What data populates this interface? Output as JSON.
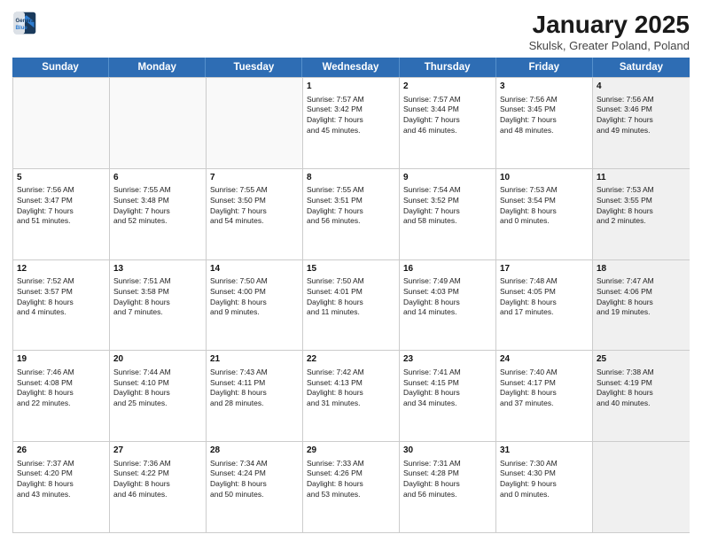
{
  "logo": {
    "line1": "General",
    "line2": "Blue"
  },
  "title": "January 2025",
  "subtitle": "Skulsk, Greater Poland, Poland",
  "days": [
    "Sunday",
    "Monday",
    "Tuesday",
    "Wednesday",
    "Thursday",
    "Friday",
    "Saturday"
  ],
  "weeks": [
    [
      {
        "day": "",
        "text": "",
        "empty": true
      },
      {
        "day": "",
        "text": "",
        "empty": true
      },
      {
        "day": "",
        "text": "",
        "empty": true
      },
      {
        "day": "1",
        "text": "Sunrise: 7:57 AM\nSunset: 3:42 PM\nDaylight: 7 hours\nand 45 minutes."
      },
      {
        "day": "2",
        "text": "Sunrise: 7:57 AM\nSunset: 3:44 PM\nDaylight: 7 hours\nand 46 minutes."
      },
      {
        "day": "3",
        "text": "Sunrise: 7:56 AM\nSunset: 3:45 PM\nDaylight: 7 hours\nand 48 minutes."
      },
      {
        "day": "4",
        "text": "Sunrise: 7:56 AM\nSunset: 3:46 PM\nDaylight: 7 hours\nand 49 minutes.",
        "shaded": true
      }
    ],
    [
      {
        "day": "5",
        "text": "Sunrise: 7:56 AM\nSunset: 3:47 PM\nDaylight: 7 hours\nand 51 minutes."
      },
      {
        "day": "6",
        "text": "Sunrise: 7:55 AM\nSunset: 3:48 PM\nDaylight: 7 hours\nand 52 minutes."
      },
      {
        "day": "7",
        "text": "Sunrise: 7:55 AM\nSunset: 3:50 PM\nDaylight: 7 hours\nand 54 minutes."
      },
      {
        "day": "8",
        "text": "Sunrise: 7:55 AM\nSunset: 3:51 PM\nDaylight: 7 hours\nand 56 minutes."
      },
      {
        "day": "9",
        "text": "Sunrise: 7:54 AM\nSunset: 3:52 PM\nDaylight: 7 hours\nand 58 minutes."
      },
      {
        "day": "10",
        "text": "Sunrise: 7:53 AM\nSunset: 3:54 PM\nDaylight: 8 hours\nand 0 minutes."
      },
      {
        "day": "11",
        "text": "Sunrise: 7:53 AM\nSunset: 3:55 PM\nDaylight: 8 hours\nand 2 minutes.",
        "shaded": true
      }
    ],
    [
      {
        "day": "12",
        "text": "Sunrise: 7:52 AM\nSunset: 3:57 PM\nDaylight: 8 hours\nand 4 minutes."
      },
      {
        "day": "13",
        "text": "Sunrise: 7:51 AM\nSunset: 3:58 PM\nDaylight: 8 hours\nand 7 minutes."
      },
      {
        "day": "14",
        "text": "Sunrise: 7:50 AM\nSunset: 4:00 PM\nDaylight: 8 hours\nand 9 minutes."
      },
      {
        "day": "15",
        "text": "Sunrise: 7:50 AM\nSunset: 4:01 PM\nDaylight: 8 hours\nand 11 minutes."
      },
      {
        "day": "16",
        "text": "Sunrise: 7:49 AM\nSunset: 4:03 PM\nDaylight: 8 hours\nand 14 minutes."
      },
      {
        "day": "17",
        "text": "Sunrise: 7:48 AM\nSunset: 4:05 PM\nDaylight: 8 hours\nand 17 minutes."
      },
      {
        "day": "18",
        "text": "Sunrise: 7:47 AM\nSunset: 4:06 PM\nDaylight: 8 hours\nand 19 minutes.",
        "shaded": true
      }
    ],
    [
      {
        "day": "19",
        "text": "Sunrise: 7:46 AM\nSunset: 4:08 PM\nDaylight: 8 hours\nand 22 minutes."
      },
      {
        "day": "20",
        "text": "Sunrise: 7:44 AM\nSunset: 4:10 PM\nDaylight: 8 hours\nand 25 minutes."
      },
      {
        "day": "21",
        "text": "Sunrise: 7:43 AM\nSunset: 4:11 PM\nDaylight: 8 hours\nand 28 minutes."
      },
      {
        "day": "22",
        "text": "Sunrise: 7:42 AM\nSunset: 4:13 PM\nDaylight: 8 hours\nand 31 minutes."
      },
      {
        "day": "23",
        "text": "Sunrise: 7:41 AM\nSunset: 4:15 PM\nDaylight: 8 hours\nand 34 minutes."
      },
      {
        "day": "24",
        "text": "Sunrise: 7:40 AM\nSunset: 4:17 PM\nDaylight: 8 hours\nand 37 minutes."
      },
      {
        "day": "25",
        "text": "Sunrise: 7:38 AM\nSunset: 4:19 PM\nDaylight: 8 hours\nand 40 minutes.",
        "shaded": true
      }
    ],
    [
      {
        "day": "26",
        "text": "Sunrise: 7:37 AM\nSunset: 4:20 PM\nDaylight: 8 hours\nand 43 minutes."
      },
      {
        "day": "27",
        "text": "Sunrise: 7:36 AM\nSunset: 4:22 PM\nDaylight: 8 hours\nand 46 minutes."
      },
      {
        "day": "28",
        "text": "Sunrise: 7:34 AM\nSunset: 4:24 PM\nDaylight: 8 hours\nand 50 minutes."
      },
      {
        "day": "29",
        "text": "Sunrise: 7:33 AM\nSunset: 4:26 PM\nDaylight: 8 hours\nand 53 minutes."
      },
      {
        "day": "30",
        "text": "Sunrise: 7:31 AM\nSunset: 4:28 PM\nDaylight: 8 hours\nand 56 minutes."
      },
      {
        "day": "31",
        "text": "Sunrise: 7:30 AM\nSunset: 4:30 PM\nDaylight: 9 hours\nand 0 minutes."
      },
      {
        "day": "",
        "text": "",
        "empty": true,
        "shaded": true
      }
    ]
  ]
}
